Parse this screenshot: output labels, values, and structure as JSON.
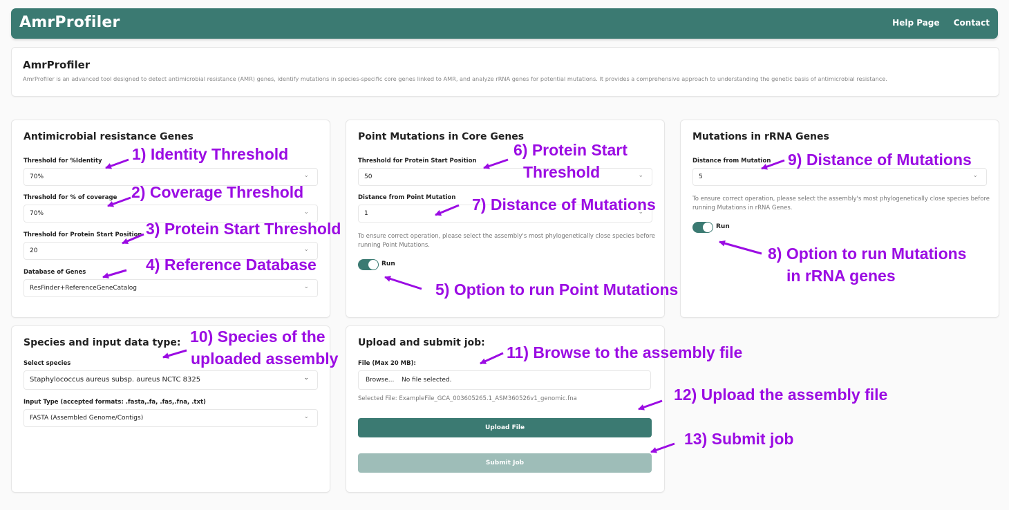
{
  "app": {
    "title": "AmrProfiler",
    "nav": [
      "Help Page",
      "Contact"
    ]
  },
  "intro": {
    "title": "AmrProfiler",
    "description": "AmrProfiler is an advanced tool designed to detect antimicrobial resistance (AMR) genes, identify mutations in species-specific core genes linked to AMR, and analyze rRNA genes for potential mutations. It provides a comprehensive approach to understanding the genetic basis of antimicrobial resistance."
  },
  "amr_genes": {
    "title": "Antimicrobial resistance Genes",
    "fields": [
      {
        "label": "Threshold for %Identity",
        "value": "70%"
      },
      {
        "label": "Threshold for % of coverage",
        "value": "70%"
      },
      {
        "label": "Threshold for Protein Start Position",
        "value": "20"
      },
      {
        "label": "Database of Genes",
        "value": "ResFinder+ReferenceGeneCatalog"
      }
    ]
  },
  "point_mutations": {
    "title": "Point Mutations in Core Genes",
    "fields": [
      {
        "label": "Threshold for Protein Start Position",
        "value": "50"
      },
      {
        "label": "Distance from Point Mutation",
        "value": "1"
      }
    ],
    "note": "To ensure correct operation, please select the assembly's most phylogenetically close species before running Point Mutations.",
    "toggle_label": "Run",
    "toggle_on": true
  },
  "rrna": {
    "title": "Mutations in rRNA Genes",
    "fields": [
      {
        "label": "Distance from Mutation",
        "value": "5"
      }
    ],
    "note": "To ensure correct operation, please select the assembly's most phylogenetically close species before running Mutations in rRNA Genes.",
    "toggle_label": "Run",
    "toggle_on": true
  },
  "species": {
    "title": "Species and input data type:",
    "fields": [
      {
        "label": "Select species",
        "value": "Staphylococcus aureus subsp. aureus NCTC 8325"
      },
      {
        "label": "Input Type (accepted formats: .fasta,.fa, .fas,.fna, .txt)",
        "value": "FASTA (Assembled Genome/Contigs)"
      }
    ]
  },
  "upload": {
    "title": "Upload and submit job:",
    "file_label": "File (Max 20 MB):",
    "browse_label": "Browse...",
    "file_status": "No file selected.",
    "selected_file": "Selected File: ExampleFile_GCA_003605265.1_ASM360526v1_genomic.fna",
    "upload_button": "Upload File",
    "submit_button": "Submit Job"
  },
  "annotations": {
    "a1": "1) Identity Threshold",
    "a2": "2) Coverage Threshold",
    "a3": "3) Protein Start Threshold",
    "a4": "4) Reference Database",
    "a5": "5) Option to run Point Mutations",
    "a6_line1": "6) Protein Start",
    "a6_line2": "Threshold",
    "a7": "7) Distance of Mutations",
    "a8_line1": "8) Option to run Mutations",
    "a8_line2": "in rRNA genes",
    "a9": "9) Distance of Mutations",
    "a10_line1": "10) Species of the",
    "a10_line2": "uploaded assembly",
    "a11": "11) Browse to the assembly file",
    "a12": "12) Upload the assembly file",
    "a13": "13) Submit job"
  },
  "colors": {
    "primary": "#3b7a72",
    "submit_disabled": "#9ebdb8",
    "annotation": "#9b0ce3"
  }
}
